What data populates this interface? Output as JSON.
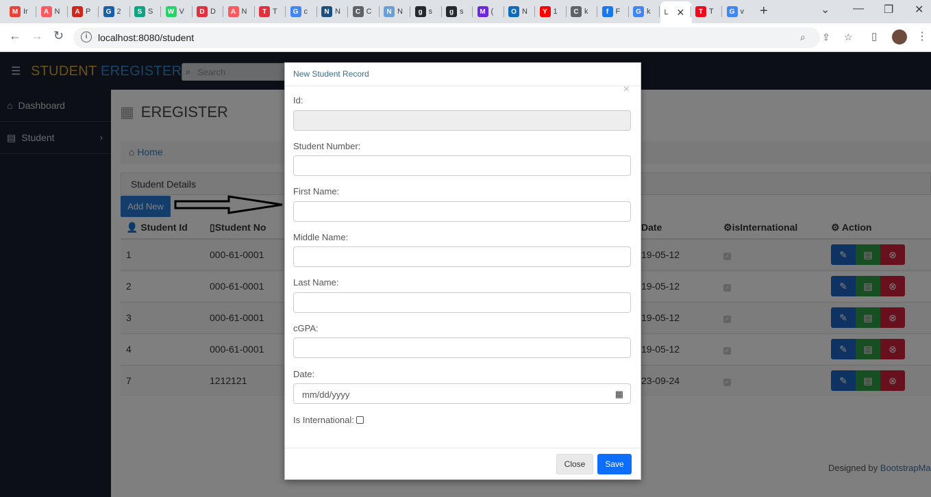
{
  "browser": {
    "tabs": [
      {
        "icon": "gmail-icon",
        "letter": "M",
        "color": "#ea4335",
        "label": "Ir"
      },
      {
        "icon": "airbnb-icon",
        "letter": "A",
        "color": "#ff5a5f",
        "label": "N"
      },
      {
        "icon": "adp-icon",
        "letter": "A",
        "color": "#d0271d",
        "label": "P"
      },
      {
        "icon": "gear-site-icon",
        "letter": "G",
        "color": "#1a5fa8",
        "label": "2"
      },
      {
        "icon": "openai-icon",
        "letter": "S",
        "color": "#10a37f",
        "label": "S"
      },
      {
        "icon": "whatsapp-icon",
        "letter": "W",
        "color": "#25d366",
        "label": "V"
      },
      {
        "icon": "ring-icon",
        "letter": "D",
        "color": "#e0313e",
        "label": "D"
      },
      {
        "icon": "airbnb-icon",
        "letter": "A",
        "color": "#ff5a5f",
        "label": "N"
      },
      {
        "icon": "target-icon",
        "letter": "T",
        "color": "#e0313e",
        "label": "T"
      },
      {
        "icon": "google-icon",
        "letter": "G",
        "color": "#4285f4",
        "label": "c"
      },
      {
        "icon": "site-icon",
        "letter": "N",
        "color": "#1f4f7f",
        "label": "N"
      },
      {
        "icon": "globe-icon",
        "letter": "C",
        "color": "#5f6368",
        "label": "C"
      },
      {
        "icon": "cloud-icon",
        "letter": "N",
        "color": "#6a9fd8",
        "label": "N"
      },
      {
        "icon": "github-icon",
        "letter": "g",
        "color": "#24292f",
        "label": "s"
      },
      {
        "icon": "github-icon",
        "letter": "g",
        "color": "#24292f",
        "label": "s"
      },
      {
        "icon": "mail-icon",
        "letter": "M",
        "color": "#6d28d9",
        "label": "("
      },
      {
        "icon": "outlook-icon",
        "letter": "O",
        "color": "#0f6cbd",
        "label": "N"
      },
      {
        "icon": "youtube-icon",
        "letter": "Y",
        "color": "#ff0000",
        "label": "1"
      },
      {
        "icon": "globe-icon",
        "letter": "C",
        "color": "#5f6368",
        "label": "k"
      },
      {
        "icon": "facebook-icon",
        "letter": "f",
        "color": "#1877f2",
        "label": "F"
      },
      {
        "icon": "google-icon",
        "letter": "G",
        "color": "#4285f4",
        "label": "k"
      },
      {
        "icon": "active-tab-icon",
        "letter": "",
        "color": "#ffffff",
        "label": "L"
      },
      {
        "icon": "toyota-icon",
        "letter": "T",
        "color": "#eb0a1e",
        "label": "T"
      },
      {
        "icon": "google-icon",
        "letter": "G",
        "color": "#4285f4",
        "label": "v"
      }
    ],
    "url": "localhost:8080/student"
  },
  "app": {
    "brand_part1": "STUDENT",
    "brand_part2": "EREGISTER",
    "search_placeholder": "Search",
    "sidebar": [
      {
        "label": "Dashboard",
        "icon": "home-icon"
      },
      {
        "label": "Student",
        "icon": "list-icon"
      }
    ],
    "page_title": "EREGISTER",
    "breadcrumb": "Home",
    "panel_title": "Student Details",
    "add_new_label": "Add New",
    "columns": [
      "Student Id",
      "Student No",
      "",
      "",
      "",
      "",
      "Date",
      "isInternational",
      "Action"
    ],
    "rows": [
      {
        "id": "1",
        "number": "000-61-0001",
        "date": "19-05-12"
      },
      {
        "id": "2",
        "number": "000-61-0001",
        "date": "19-05-12"
      },
      {
        "id": "3",
        "number": "000-61-0001",
        "date": "19-05-12"
      },
      {
        "id": "4",
        "number": "000-61-0001",
        "date": "19-05-12"
      },
      {
        "id": "7",
        "number": "1212121",
        "date": "23-09-24"
      }
    ],
    "footer_text": "Designed by",
    "footer_link": "BootstrapMa"
  },
  "modal": {
    "title": "New Student Record",
    "fields": [
      {
        "label": "Id:",
        "placeholder": ""
      },
      {
        "label": "Student Number:",
        "placeholder": ""
      },
      {
        "label": "First Name:",
        "placeholder": ""
      },
      {
        "label": "Middle Name:",
        "placeholder": ""
      },
      {
        "label": "Last Name:",
        "placeholder": ""
      },
      {
        "label": "cGPA:",
        "placeholder": ""
      },
      {
        "label": "Date:",
        "placeholder": "mm/dd/yyyy"
      }
    ],
    "international_label": "Is International:",
    "close_label": "Close",
    "save_label": "Save"
  }
}
